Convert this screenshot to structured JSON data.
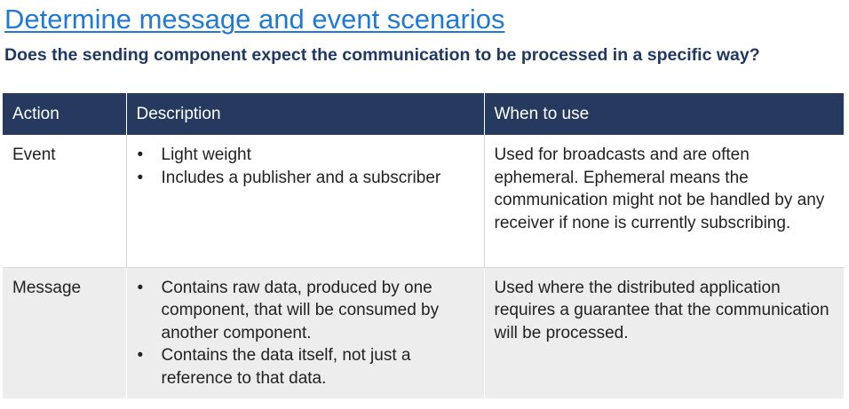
{
  "title": "Determine message and event scenarios",
  "subtitle": "Does the sending component expect the communication to be processed in a specific way?",
  "table": {
    "headers": [
      "Action",
      "Description",
      "When to use"
    ],
    "rows": [
      {
        "action": "Event",
        "description": [
          "Light weight",
          "Includes a publisher and a subscriber"
        ],
        "when_to_use": "Used for broadcasts and are often ephemeral. Ephemeral means the communication might not be handled by any receiver if none is currently subscribing."
      },
      {
        "action": "Message",
        "description": [
          "Contains raw data, produced by one component, that will be consumed by another component.",
          "Contains the data itself, not just a reference to that data."
        ],
        "when_to_use": "Used where the distributed application requires a guarantee that the communication will be processed."
      }
    ]
  },
  "colors": {
    "title": "#1f7ad6",
    "subtitle": "#203864",
    "header_bg": "#253a5e",
    "alt_row_bg": "#ededed"
  },
  "bullet_glyph": "•"
}
